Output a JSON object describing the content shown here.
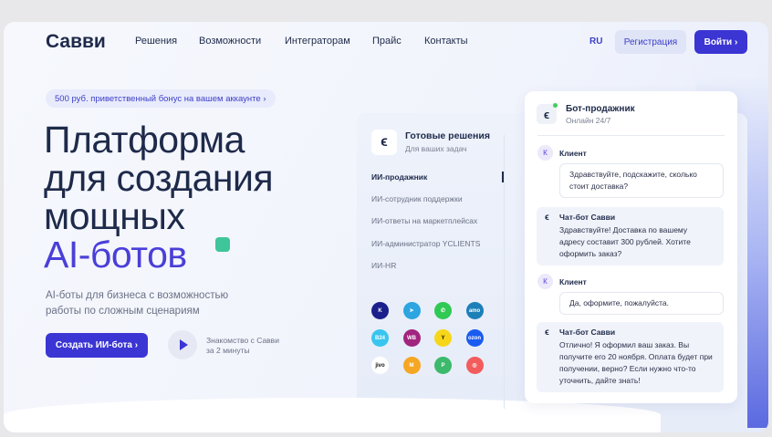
{
  "header": {
    "logo": "Савви",
    "nav": [
      "Решения",
      "Возможности",
      "Интеграторам",
      "Прайс",
      "Контакты"
    ],
    "lang": "RU",
    "register": "Регистрация",
    "login": "Войти ›"
  },
  "hero": {
    "bonus": "500 руб. приветственный бонус на вашем аккаунте ›",
    "title_lines": [
      "Платформа",
      "для создания",
      "мощных"
    ],
    "title_accent": "AI-ботов",
    "subtitle_lines": [
      "AI-боты для бизнеса с возможностью",
      "работы по сложным сценариям"
    ],
    "cta": "Создать ИИ-бота ›",
    "video_lines": [
      "Знакомство с Савви",
      "за 2 минуты"
    ]
  },
  "solutions": {
    "title": "Готовые решения",
    "subtitle": "Для ваших задач",
    "items": [
      "ИИ-продажник",
      "ИИ-сотрудник поддержки",
      "ИИ-ответы на маркетплейсах",
      "ИИ-администратор YCLIENTS",
      "ИИ-HR"
    ],
    "integrations": [
      {
        "name": "Контур",
        "label": "K",
        "color": "#1a1f8c"
      },
      {
        "name": "Telegram",
        "label": "➤",
        "color": "#2ca5e0"
      },
      {
        "name": "WhatsApp",
        "label": "✆",
        "color": "#2fc954"
      },
      {
        "name": "amoCRM",
        "label": "amo",
        "color": "#1c7fb8"
      },
      {
        "name": "Bitrix",
        "label": "B24",
        "color": "#38c5f0"
      },
      {
        "name": "Wildberries",
        "label": "WB",
        "color": "#a1247e"
      },
      {
        "name": "Yandex Market",
        "label": "Y",
        "color": "#f7d61a"
      },
      {
        "name": "Ozon",
        "label": "ozon",
        "color": "#1a5cf0"
      },
      {
        "name": "Jivo",
        "label": "jivo",
        "color": "#ffffff"
      },
      {
        "name": "Маркет",
        "label": "M",
        "color": "#f5a623"
      },
      {
        "name": "Flag",
        "label": "P",
        "color": "#3cb96a"
      },
      {
        "name": "Support",
        "label": "◎",
        "color": "#f25c5c"
      }
    ]
  },
  "chat": {
    "title": "Бот-продажник",
    "status": "Онлайн 24/7",
    "client_initial": "К",
    "client_name": "Клиент",
    "bot_name": "Чат-бот Савви",
    "messages": [
      "Здравствуйте, подскажите, сколько стоит доставка?",
      "Здравствуйте! Доставка по вашему адресу составит 300 рублей. Хотите оформить заказ?",
      "Да, оформите, пожалуйста.",
      "Отлично! Я оформил ваш заказ. Вы получите его 20 ноября. Оплата будет при получении, верно? Если нужно что-то уточнить, дайте знать!"
    ]
  }
}
